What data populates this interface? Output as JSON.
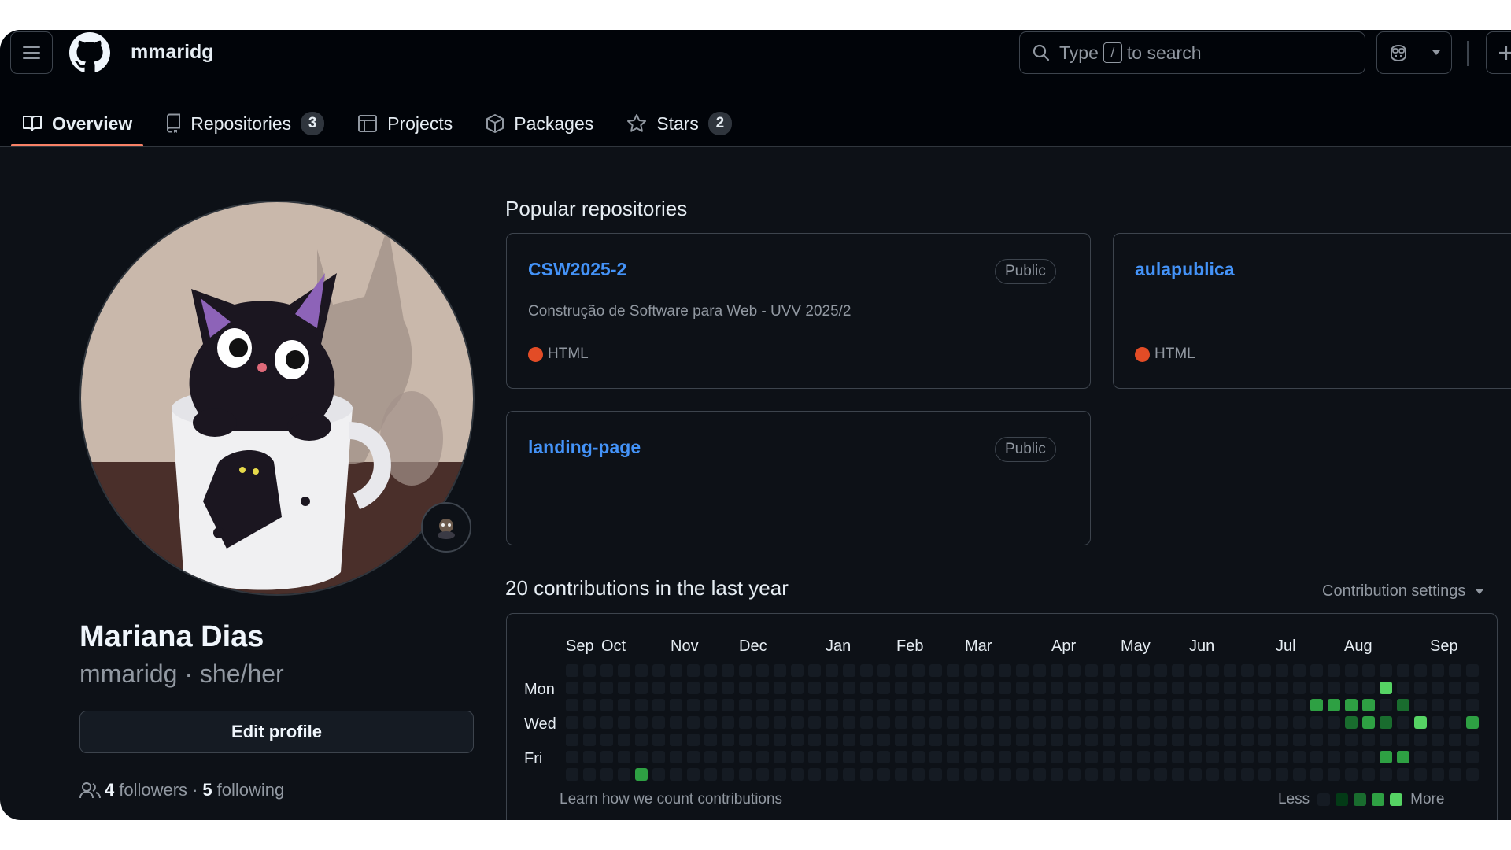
{
  "header": {
    "username": "mmaridg",
    "search": {
      "prefix": "Type",
      "key": "/",
      "suffix": "to search"
    }
  },
  "tabs": [
    {
      "label": "Overview",
      "icon": "book-icon",
      "active": true
    },
    {
      "label": "Repositories",
      "icon": "repo-icon",
      "count": "3"
    },
    {
      "label": "Projects",
      "icon": "table-icon"
    },
    {
      "label": "Packages",
      "icon": "package-icon"
    },
    {
      "label": "Stars",
      "icon": "star-icon",
      "count": "2"
    }
  ],
  "profile": {
    "full_name": "Mariana Dias",
    "login": "mmaridg",
    "separator": "·",
    "pronouns": "she/her",
    "edit_label": "Edit profile",
    "followers_count": "4",
    "followers_label": "followers",
    "dot": "·",
    "following_count": "5",
    "following_label": "following"
  },
  "popular": {
    "title": "Popular repositories",
    "repos": [
      {
        "name": "CSW2025-2",
        "visibility": "Public",
        "description": "Construção de Software para Web - UVV 2025/2",
        "language": "HTML",
        "language_color": "#e34c26"
      },
      {
        "name": "aulapublica",
        "language": "HTML",
        "language_color": "#e34c26"
      },
      {
        "name": "landing-page",
        "visibility": "Public"
      }
    ]
  },
  "contributions": {
    "title": "20 contributions in the last year",
    "settings_label": "Contribution settings",
    "months": [
      "Sep",
      "Oct",
      "Nov",
      "Dec",
      "Jan",
      "Feb",
      "Mar",
      "Apr",
      "May",
      "Jun",
      "Jul",
      "Aug",
      "Sep"
    ],
    "days": [
      "Mon",
      "Wed",
      "Fri"
    ],
    "learn_link": "Learn how we count contributions",
    "legend_less": "Less",
    "legend_more": "More",
    "colors": {
      "empty": "#151b23",
      "l1": "#033a16",
      "l2": "#196c2e",
      "l3": "#2ea043",
      "l4": "#56d364"
    },
    "active_cells": [
      {
        "week": 7,
        "day": 6,
        "level": 3
      },
      {
        "week": 46,
        "day": 2,
        "level": 3
      },
      {
        "week": 47,
        "day": 2,
        "level": 3
      },
      {
        "week": 48,
        "day": 2,
        "level": 3
      },
      {
        "week": 48,
        "day": 3,
        "level": 2
      },
      {
        "week": 49,
        "day": 2,
        "level": 3
      },
      {
        "week": 49,
        "day": 3,
        "level": 3
      },
      {
        "week": 50,
        "day": 1,
        "level": 4
      },
      {
        "week": 50,
        "day": 3,
        "level": 2
      },
      {
        "week": 50,
        "day": 5,
        "level": 3
      },
      {
        "week": 51,
        "day": 2,
        "level": 2
      },
      {
        "week": 51,
        "day": 5,
        "level": 3
      },
      {
        "week": 52,
        "day": 3,
        "level": 4
      },
      {
        "week": 55,
        "day": 3,
        "level": 3
      }
    ]
  }
}
